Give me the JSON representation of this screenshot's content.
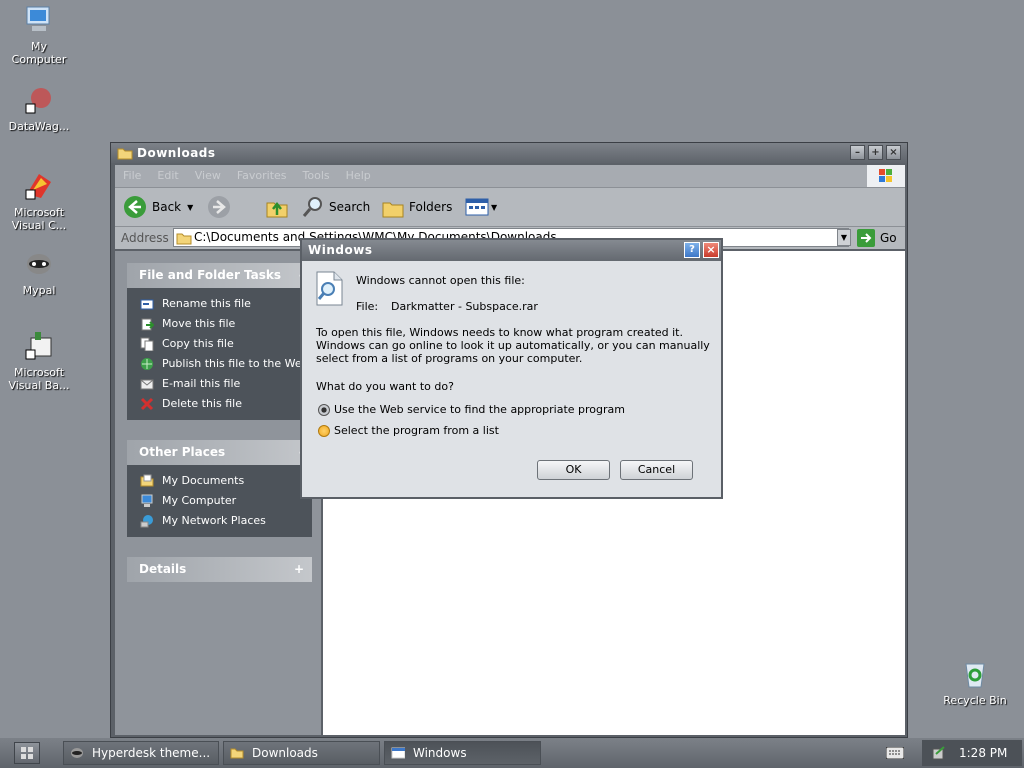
{
  "desktop": {
    "icons": [
      {
        "label": "My\nComputer",
        "icon": "my-computer-icon"
      },
      {
        "label": "DataWag...",
        "icon": "datawag-icon"
      },
      {
        "label": "Microsoft\nVisual C...",
        "icon": "visual-c-icon"
      },
      {
        "label": "Mypal",
        "icon": "mypal-icon"
      },
      {
        "label": "Microsoft\nVisual Ba...",
        "icon": "visual-basic-icon"
      },
      {
        "label": "Recycle Bin",
        "icon": "recycle-bin-icon"
      }
    ]
  },
  "explorer": {
    "title": "Downloads",
    "menu": [
      "File",
      "Edit",
      "View",
      "Favorites",
      "Tools",
      "Help"
    ],
    "toolbar": {
      "back": "Back",
      "search": "Search",
      "folders": "Folders"
    },
    "address": {
      "label": "Address",
      "value": "C:\\Documents and Settings\\WMC\\My Documents\\Downloads",
      "go": "Go"
    },
    "tasks_panel": {
      "title": "File and Folder Tasks",
      "toggle": "-",
      "items": [
        "Rename this file",
        "Move this file",
        "Copy this file",
        "Publish this file to the Web",
        "E-mail this file",
        "Delete this file"
      ]
    },
    "places_panel": {
      "title": "Other Places",
      "toggle": "-",
      "items": [
        "My Documents",
        "My Computer",
        "My Network Places"
      ]
    },
    "details_panel": {
      "title": "Details",
      "toggle": "+"
    }
  },
  "dialog": {
    "title": "Windows",
    "message": "Windows cannot open this file:",
    "file_label": "File:",
    "file_name": "Darkmatter - Subspace.rar",
    "explanation": "To open this file, Windows needs to know what program created it.  Windows can go online to look it up automatically, or you can manually select from a list of programs on your computer.",
    "question": "What do you want to do?",
    "options": [
      "Use the Web service to find the appropriate program",
      "Select the program from a list"
    ],
    "selected_option": 0,
    "ok": "OK",
    "cancel": "Cancel"
  },
  "taskbar": {
    "tasks": [
      "Hyperdesk theme...",
      "Downloads",
      "Windows"
    ],
    "active_task": 2,
    "clock": "1:28 PM"
  }
}
